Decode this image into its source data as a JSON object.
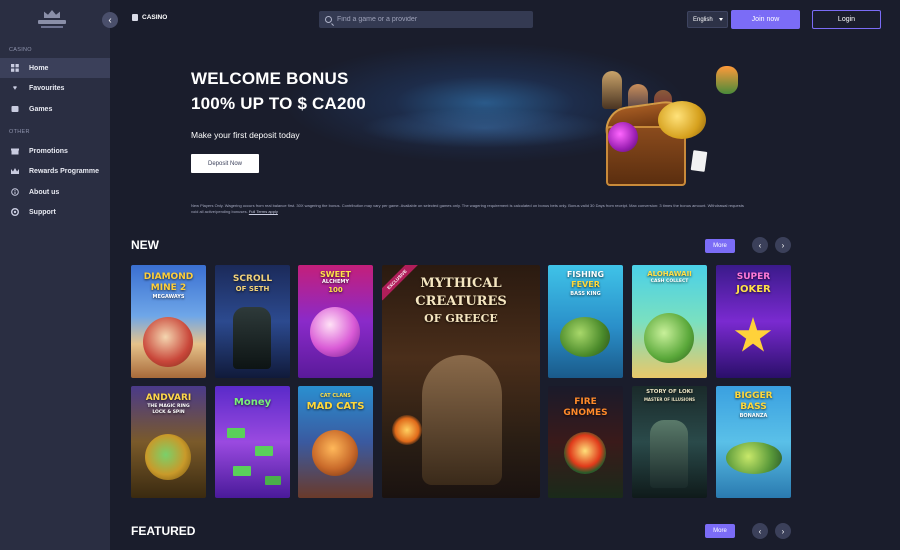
{
  "sidebar": {
    "casino_label": "CASINO",
    "other_label": "OTHER",
    "casino_items": [
      {
        "label": "Home",
        "icon": "grid-icon"
      },
      {
        "label": "Favourites",
        "icon": "heart-icon"
      },
      {
        "label": "Games",
        "icon": "games-icon"
      }
    ],
    "other_items": [
      {
        "label": "Promotions",
        "icon": "gift-icon"
      },
      {
        "label": "Rewards Programme",
        "icon": "crown-icon"
      },
      {
        "label": "About us",
        "icon": "info-icon"
      },
      {
        "label": "Support",
        "icon": "support-icon"
      }
    ]
  },
  "topbar": {
    "breadcrumb": "CASINO",
    "search_placeholder": "Find a game or a provider",
    "language": "English",
    "join_label": "Join now",
    "login_label": "Login"
  },
  "banner": {
    "title_line1": "WELCOME BONUS",
    "title_line2": "100% UP TO $ CA200",
    "subtitle": "Make your first deposit today",
    "cta_label": "Deposit Now",
    "terms": "New Players Only. Wagering occurs from real balance first. 30X wagering the bonus. Contribution may vary per game. Available on selected games only. The wagering requirement is calculated on bonus bets only. Bonus valid 30 Days from receipt. Max conversion: 3 times the bonus amount. Withdrawal requests void all active/pending bonuses.",
    "terms_link": "Full Terms apply"
  },
  "sections": {
    "new_title": "NEW",
    "featured_title": "FEATURED",
    "more_label": "More"
  },
  "games": {
    "exclusive_label": "EXCLUSIVE",
    "g1": {
      "line1": "DIAMOND",
      "line2": "MINE 2",
      "line3": "MEGAWAYS"
    },
    "g2": {
      "line1": "SCROLL",
      "line2": "OF SETH"
    },
    "g3": {
      "line1": "SWEET",
      "line2": "ALCHEMY",
      "line3": "100"
    },
    "g4": {
      "line1": "MYTHICAL",
      "line2": "CREATURES",
      "line3": "OF GREECE"
    },
    "g5": {
      "line1": "FISHING",
      "line2": "FEVER",
      "line3": "BASS KING"
    },
    "g6": {
      "line1": "ALOHAWAII",
      "line2": "CASH COLLECT"
    },
    "g7": {
      "line1": "SUPER",
      "line2": "JOKER"
    },
    "g8": {
      "line1": "ANDVARI",
      "line2": "THE MAGIC RING",
      "line3": "LOCK & SPIN"
    },
    "g9": {
      "line1": "Money",
      "line2": ""
    },
    "g10": {
      "line1": "CAT CLANS",
      "line2": "MAD CATS"
    },
    "g11": {
      "line1": "FIRE",
      "line2": "GNOMES"
    },
    "g12": {
      "line1": "STORY OF LOKI",
      "line2": "MASTER OF ILLUSIONS"
    },
    "g13": {
      "line1": "BIGGER",
      "line2": "BASS",
      "line3": "BONANZA"
    }
  }
}
